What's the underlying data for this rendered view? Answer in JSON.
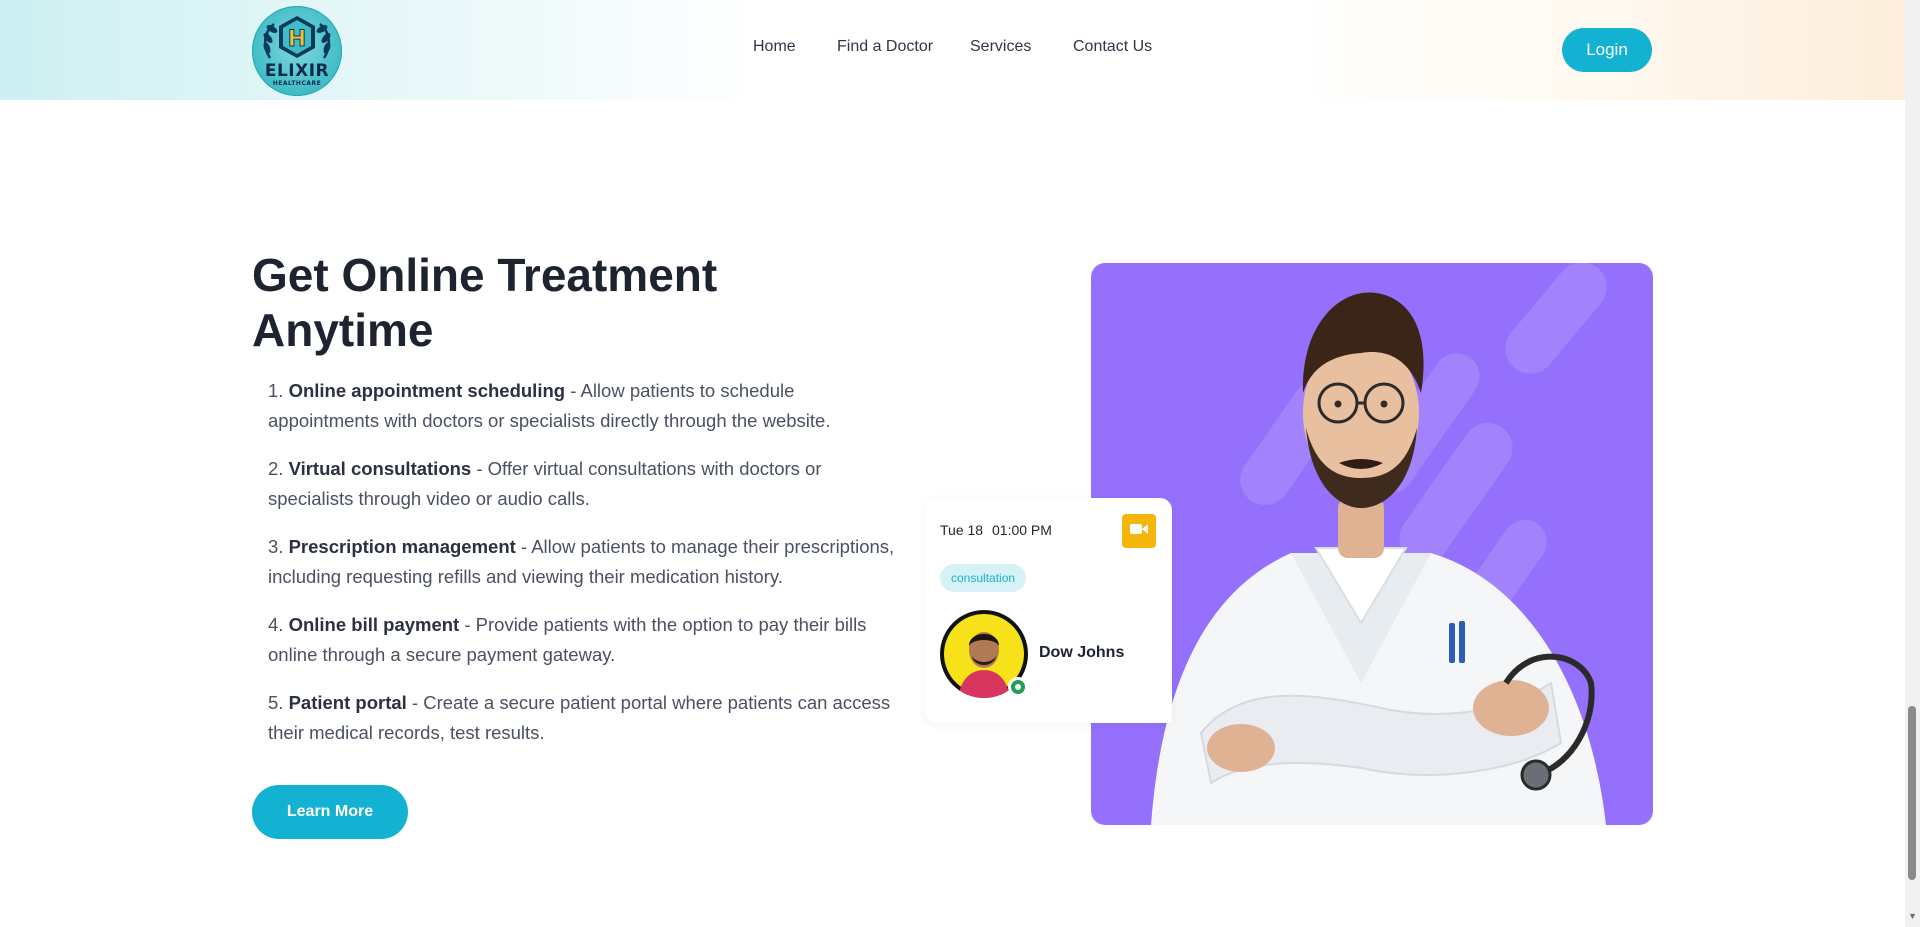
{
  "header": {
    "logo": {
      "line1": "ELIXIR",
      "line2": "HEALTHCARE",
      "monogram": "H"
    },
    "nav": [
      {
        "label": "Home"
      },
      {
        "label": "Find a Doctor"
      },
      {
        "label": "Services"
      },
      {
        "label": "Contact Us"
      }
    ],
    "login_label": "Login"
  },
  "section": {
    "title": "Get Online Treatment Anytime",
    "features": [
      {
        "num": "1.",
        "title": "Online appointment scheduling",
        "desc": " - Allow patients to schedule appointments with doctors or specialists directly through the website."
      },
      {
        "num": "2.",
        "title": "Virtual consultations",
        "desc": " - Offer virtual consultations with doctors or specialists through video or audio calls."
      },
      {
        "num": "3.",
        "title": "Prescription management",
        "desc": " - Allow patients to manage their prescriptions, including requesting refills and viewing their medication history."
      },
      {
        "num": "4.",
        "title": "Online bill payment",
        "desc": " - Provide patients with the option to pay their bills online through a secure payment gateway."
      },
      {
        "num": "5.",
        "title": "Patient portal",
        "desc": " - Create a secure patient portal where patients can access their medical records, test results."
      }
    ],
    "learn_more_label": "Learn More"
  },
  "appointment": {
    "date": "Tue 18",
    "time": "01:00 PM",
    "tag": "consultation",
    "doctor_name": "Dow Johns",
    "video_icon": "video-camera-icon"
  },
  "colors": {
    "accent": "#13b2d2",
    "purple": "#9570fc",
    "video_yellow": "#f5b50a",
    "online_green": "#1e9e57"
  }
}
